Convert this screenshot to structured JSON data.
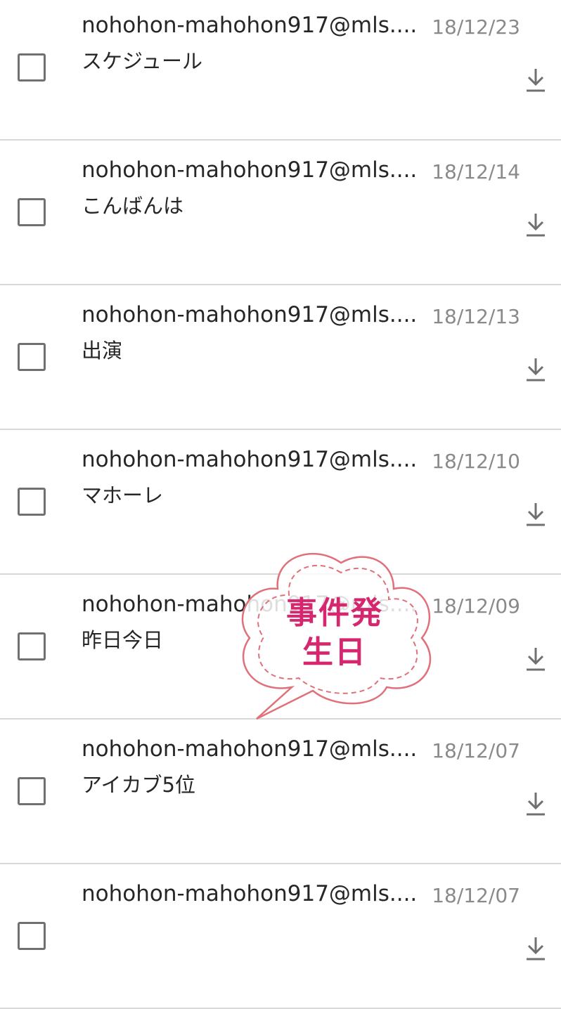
{
  "messages": [
    {
      "sender": "nohohon-mahohon917@mls....",
      "subject": "スケジュール",
      "date": "18/12/23"
    },
    {
      "sender": "nohohon-mahohon917@mls....",
      "subject": "こんばんは",
      "date": "18/12/14"
    },
    {
      "sender": "nohohon-mahohon917@mls....",
      "subject": "出演",
      "date": "18/12/13"
    },
    {
      "sender": "nohohon-mahohon917@mls....",
      "subject": "マホーレ",
      "date": "18/12/10"
    },
    {
      "sender": "nohohon-mahohon917@mls....",
      "subject": "昨日今日",
      "date": "18/12/09"
    },
    {
      "sender": "nohohon-mahohon917@mls....",
      "subject": "アイカブ5位",
      "date": "18/12/07"
    },
    {
      "sender": "nohohon-mahohon917@mls....",
      "subject": "",
      "date": "18/12/07"
    }
  ],
  "annotation": {
    "line1": "事件発",
    "line2": "生日",
    "color": "#d6266e",
    "border_color": "#e0707a"
  },
  "icons": {
    "checkbox": "checkbox-unchecked-icon",
    "download": "download-icon"
  }
}
